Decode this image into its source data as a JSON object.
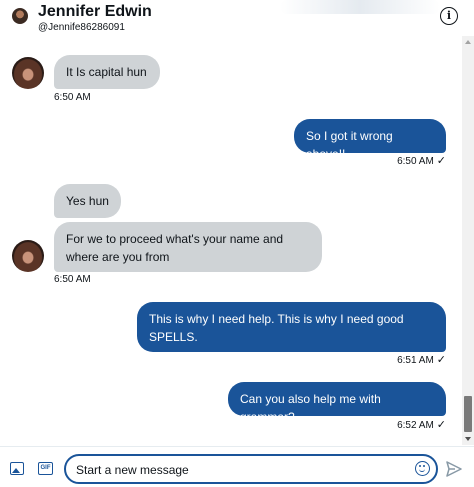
{
  "header": {
    "name": "Jennifer Edwin",
    "handle": "@Jennife86286091",
    "info_icon": "i"
  },
  "messages": [
    {
      "side": "in",
      "text": "It Is capital hun",
      "time": "6:50 AM"
    },
    {
      "side": "out",
      "text": "So I got it wrong above!!",
      "time": "6:50 AM",
      "check": "✓"
    },
    {
      "side": "in",
      "text": "Yes hun"
    },
    {
      "side": "in",
      "text": "For we to proceed what's your name and where are you from",
      "time": "6:50 AM"
    },
    {
      "side": "out",
      "text": "This is why I need help.  This is why I need good SPELLS.",
      "time": "6:51 AM",
      "check": "✓"
    },
    {
      "side": "out",
      "text": "Can you also help me with grammar?",
      "time": "6:52 AM",
      "check": "✓"
    }
  ],
  "composer": {
    "placeholder": "Start a new message",
    "gif_label": "GIF"
  },
  "colors": {
    "outgoing_bubble": "#1a5499",
    "incoming_bubble": "#cfd3d6",
    "accent": "#1a5499"
  },
  "icons": [
    "info-icon",
    "image-icon",
    "gif-icon",
    "emoji-icon",
    "send-icon",
    "check-icon"
  ]
}
